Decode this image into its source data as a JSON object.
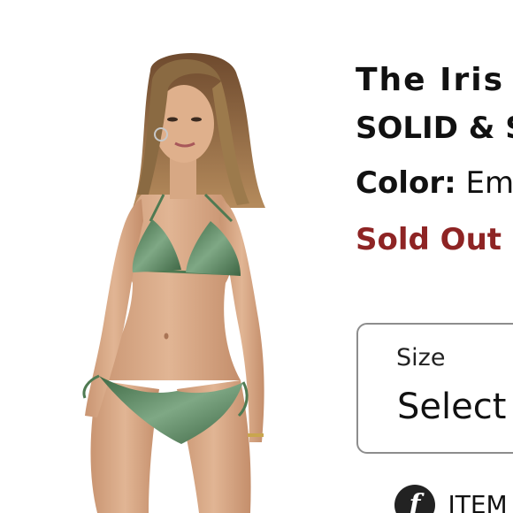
{
  "product": {
    "title": "The Iris",
    "subtitle": "SOLID & S",
    "color_label": "Color:",
    "color_value": "Em",
    "status": "Sold Out"
  },
  "size_selector": {
    "label": "Size",
    "value": "Select"
  },
  "footer": {
    "icon": "f",
    "text": "ITEM"
  },
  "colors": {
    "sold_out": "#8e2424",
    "swimsuit": "#4f7a52",
    "border": "#8d8d8d"
  }
}
